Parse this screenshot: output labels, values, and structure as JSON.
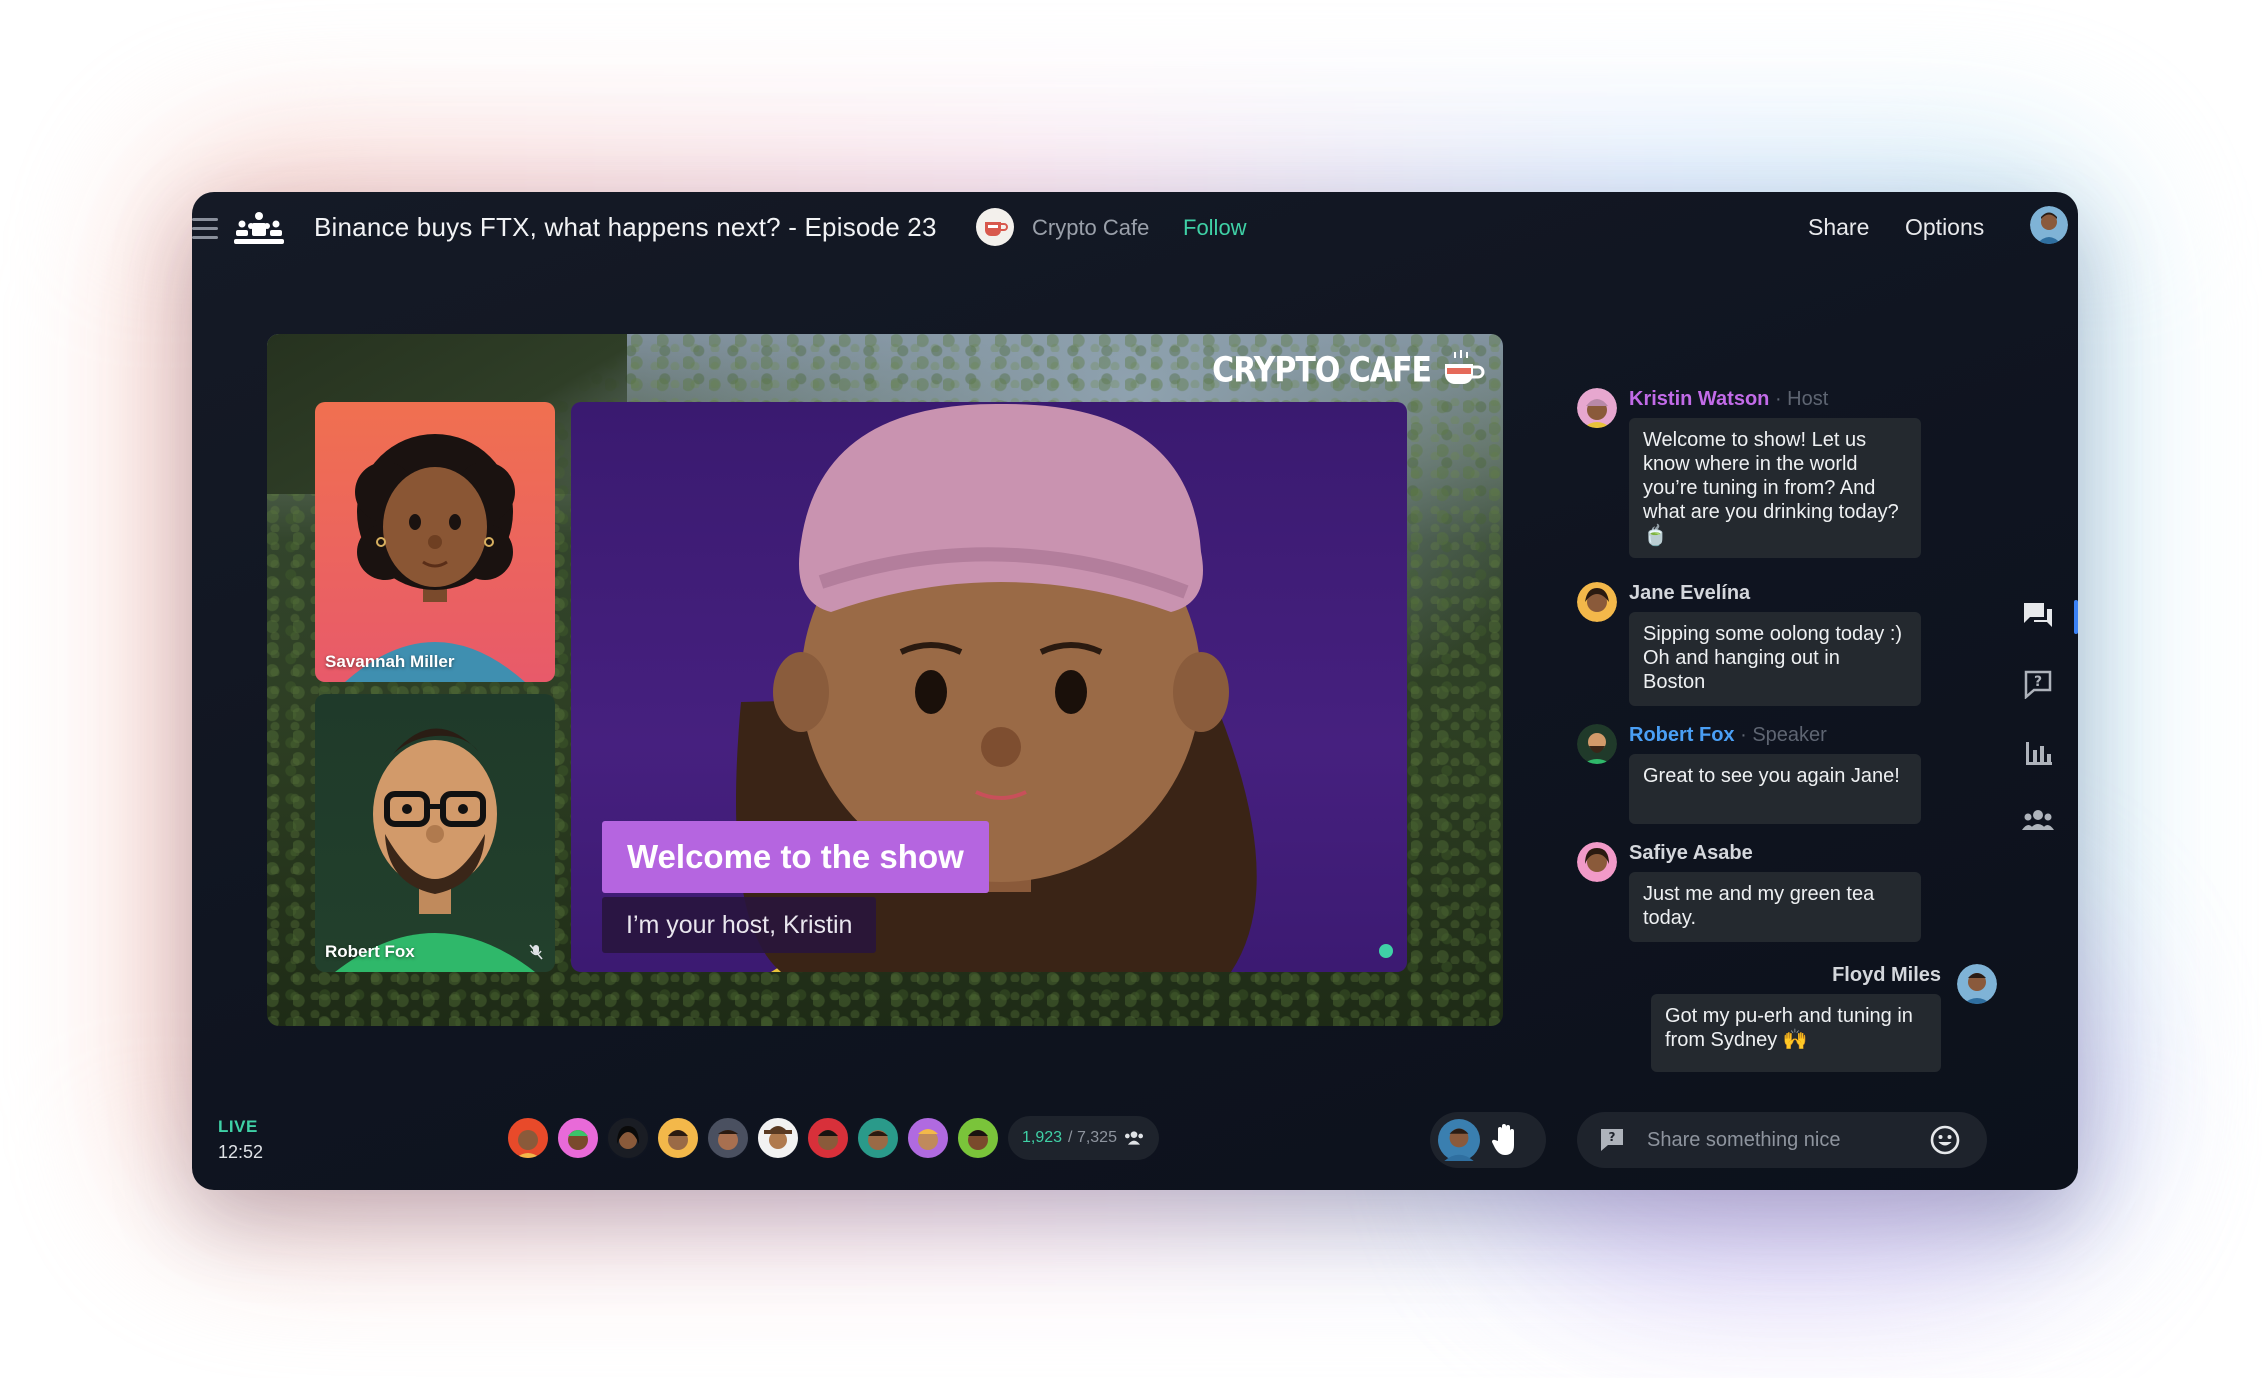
{
  "header": {
    "title": "Binance buys FTX, what happens next? - Episode 23",
    "channel_name": "Crypto Cafe",
    "follow_label": "Follow",
    "share_label": "Share",
    "options_label": "Options"
  },
  "stage": {
    "brand_text": "CRYPTO CAFE",
    "tiles": [
      {
        "name": "Savannah Miller"
      },
      {
        "name": "Robert Fox"
      }
    ],
    "lower_third_title": "Welcome to the show",
    "lower_third_subtitle": "I’m your host, Kristin"
  },
  "chat": {
    "messages": [
      {
        "name": "Kristin Watson",
        "role": "· Host",
        "text": "Welcome to show! Let us know where in the world you’re tuning in from? And what are you drinking today? 🍵"
      },
      {
        "name": "Jane Evelína",
        "role": "",
        "text": "Sipping some oolong today :) Oh and hanging out in Boston"
      },
      {
        "name": "Robert Fox",
        "role": "· Speaker",
        "text": "Great to see you again Jane!"
      },
      {
        "name": "Safiye Asabe",
        "role": "",
        "text": "Just me and my green tea today."
      },
      {
        "name": "Floyd Miles",
        "role": "",
        "text": "Got my pu-erh and tuning in from Sydney 🙌"
      }
    ],
    "input_placeholder": "Share something nice"
  },
  "footer": {
    "live_label": "LIVE",
    "live_time": "12:52",
    "viewer_count_active": "1,923",
    "viewer_count_total": "/ 7,325"
  },
  "colors": {
    "accent_green": "#3fd1a6",
    "host_purple": "#c26be8",
    "speaker_blue": "#4a9ff5",
    "lower_third": "#b565e0",
    "window_bg": "#0f1420"
  },
  "icons": {
    "menu": "hamburger-icon",
    "logo": "audience-logo-icon",
    "chat_tab": "chat-bubbles-icon",
    "qa_tab": "question-icon",
    "poll_tab": "bar-chart-icon",
    "people_tab": "people-icon",
    "raise_hand": "hand-icon",
    "emoji": "smiley-icon"
  }
}
